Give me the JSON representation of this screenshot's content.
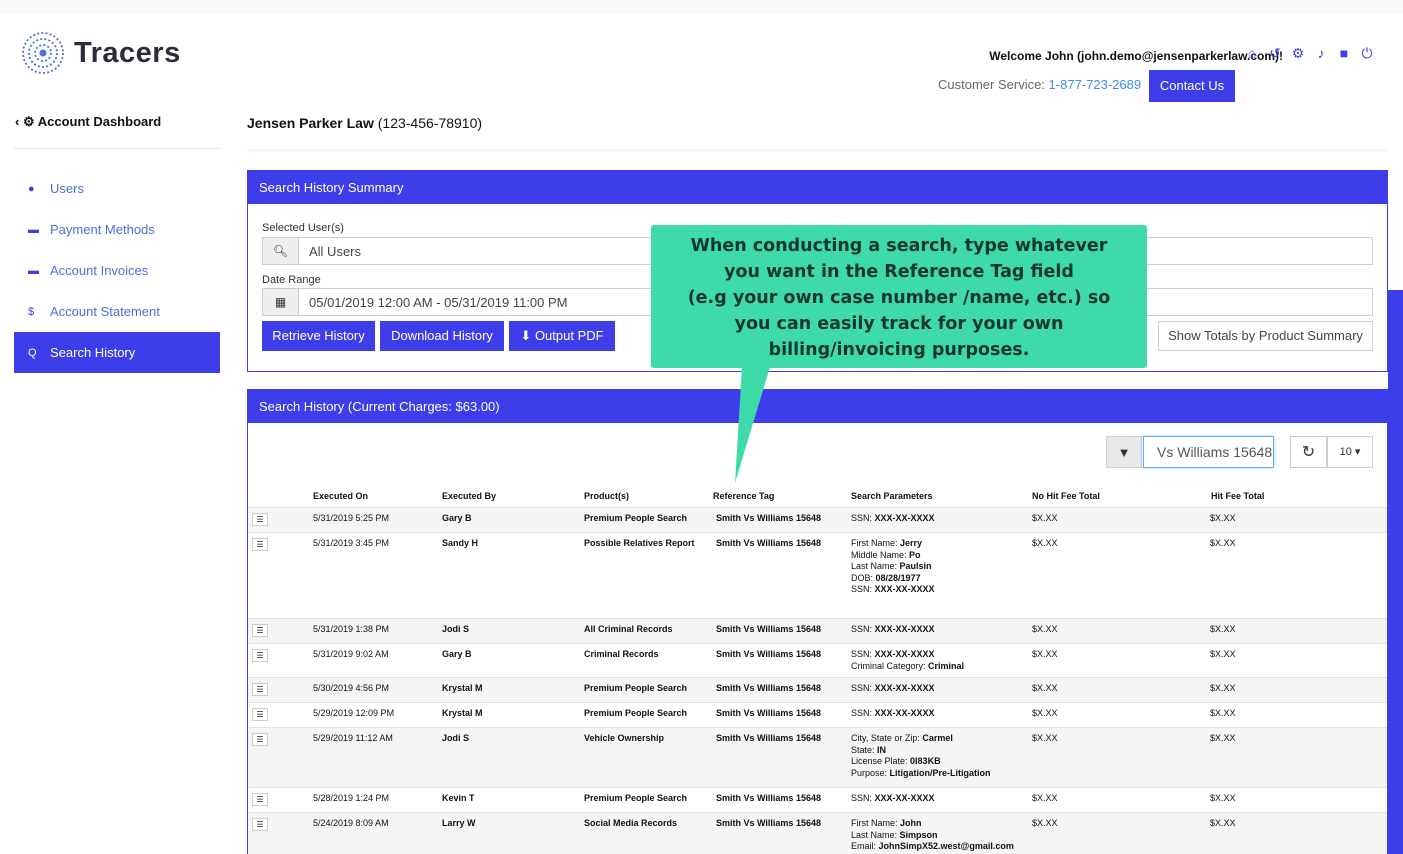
{
  "app": {
    "name": "Tracers"
  },
  "header": {
    "welcome": "Welcome John (john.demo@jensenparkerlaw.com)!",
    "cs_label": "Customer Service: ",
    "cs_phone": "1-877-723-2689",
    "contact_label": "Contact Us"
  },
  "sidebar": {
    "back_label": "‹ ⚙ Account Dashboard",
    "items": [
      {
        "label": "Users",
        "icon": "user-icon"
      },
      {
        "label": "Payment Methods",
        "icon": "credit-card-icon"
      },
      {
        "label": "Account Invoices",
        "icon": "credit-card-icon"
      },
      {
        "label": "Account Statement",
        "icon": "dollar-icon"
      },
      {
        "label": "Search History",
        "icon": "search-icon",
        "active": true
      }
    ]
  },
  "account": {
    "name": "Jensen Parker Law",
    "number": "(123-456-78910)"
  },
  "summary": {
    "title": "Search History Summary",
    "users_label": "Selected User(s)",
    "users_value": "All Users",
    "date_label": "Date Range",
    "date_value": "05/01/2019 12:00 AM - 05/31/2019 11:00 PM",
    "retrieve_label": "Retrieve History",
    "download_label": "Download History",
    "pdf_label": "Output PDF",
    "totals_label": "Show Totals by Product Summary"
  },
  "tooltip": {
    "lines": [
      "When conducting a search, type whatever",
      "you want in the Reference Tag field",
      "(e.g your own case number /name, etc.) so",
      "you can easily track for your own",
      "billing/invoicing purposes."
    ]
  },
  "history": {
    "title": "Search History (Current Charges: $63.00)",
    "search_value": "Vs Williams 15648",
    "page_size": "10 ▾",
    "columns": [
      "Executed On",
      "Executed By",
      "Product(s)",
      "Reference Tag",
      "Search Parameters",
      "No Hit Fee Total",
      "Hit Fee Total"
    ],
    "rows": [
      {
        "on": "5/31/2019 5:25 PM",
        "by": "Gary B",
        "product": "Premium People Search",
        "ref": "Smith Vs Williams 15648",
        "params": [
          [
            "SSN: ",
            "XXX-XX-XXXX"
          ]
        ],
        "nohit": "$X.XX",
        "hit": "$X.XX"
      },
      {
        "on": "5/31/2019 3:45 PM",
        "by": "Sandy H",
        "product": "Possible Relatives Report",
        "ref": "Smith Vs Williams 15648",
        "params": [
          [
            "First Name: ",
            "Jerry"
          ],
          [
            "Middle Name: ",
            "Po"
          ],
          [
            "Last Name: ",
            "Paulsin"
          ],
          [
            "DOB: ",
            "08/28/1977"
          ],
          [
            "SSN: ",
            "XXX-XX-XXXX"
          ]
        ],
        "nohit": "$X.XX",
        "hit": "$X.XX"
      },
      {
        "on": "5/31/2019 1:38 PM",
        "by": "Jodi S",
        "product": "All Criminal Records",
        "ref": "Smith Vs Williams 15648",
        "params": [
          [
            "SSN: ",
            "XXX-XX-XXXX"
          ]
        ],
        "nohit": "$X.XX",
        "hit": "$X.XX"
      },
      {
        "on": "5/31/2019 9:02 AM",
        "by": "Gary B",
        "product": "Criminal Records",
        "ref": "Smith Vs Williams 15648",
        "params": [
          [
            "SSN: ",
            "XXX-XX-XXXX"
          ],
          [
            "Criminal Category: ",
            "Criminal"
          ]
        ],
        "nohit": "$X.XX",
        "hit": "$X.XX"
      },
      {
        "on": "5/30/2019 4:56 PM",
        "by": "Krystal M",
        "product": "Premium People Search",
        "ref": "Smith Vs Williams 15648",
        "params": [
          [
            "SSN: ",
            "XXX-XX-XXXX"
          ]
        ],
        "nohit": "$X.XX",
        "hit": "$X.XX"
      },
      {
        "on": "5/29/2019 12:09 PM",
        "by": "Krystal M",
        "product": "Premium People Search",
        "ref": "Smith Vs Williams 15648",
        "params": [
          [
            "SSN: ",
            "XXX-XX-XXXX"
          ]
        ],
        "nohit": "$X.XX",
        "hit": "$X.XX"
      },
      {
        "on": "5/29/2019 11:12 AM",
        "by": "Jodi S",
        "product": "Vehicle Ownership",
        "ref": "Smith Vs Williams 15648",
        "params": [
          [
            "City, State or Zip: ",
            "Carmel"
          ],
          [
            "State: ",
            "IN"
          ],
          [
            "License Plate: ",
            "0I83KB"
          ],
          [
            "Purpose: ",
            "Litigation/Pre-Litigation"
          ]
        ],
        "nohit": "$X.XX",
        "hit": "$X.XX"
      },
      {
        "on": "5/28/2019 1:24 PM",
        "by": "Kevin T",
        "product": "Premium People Search",
        "ref": "Smith Vs Williams 15648",
        "params": [
          [
            "SSN: ",
            "XXX-XX-XXXX"
          ]
        ],
        "nohit": "$X.XX",
        "hit": "$X.XX"
      },
      {
        "on": "5/24/2019 8:09 AM",
        "by": "Larry W",
        "product": "Social Media Records",
        "ref": "Smith Vs Williams 15648",
        "params": [
          [
            "First Name: ",
            "John"
          ],
          [
            "Last Name: ",
            "Simpson"
          ],
          [
            "Email: ",
            "JohnSimpX52.west@gmail.com"
          ]
        ],
        "nohit": "$X.XX",
        "hit": "$X.XX"
      }
    ]
  },
  "colors": {
    "accent": "#3d3dea",
    "tooltip": "#3edaa9",
    "link": "#3d8df2"
  }
}
